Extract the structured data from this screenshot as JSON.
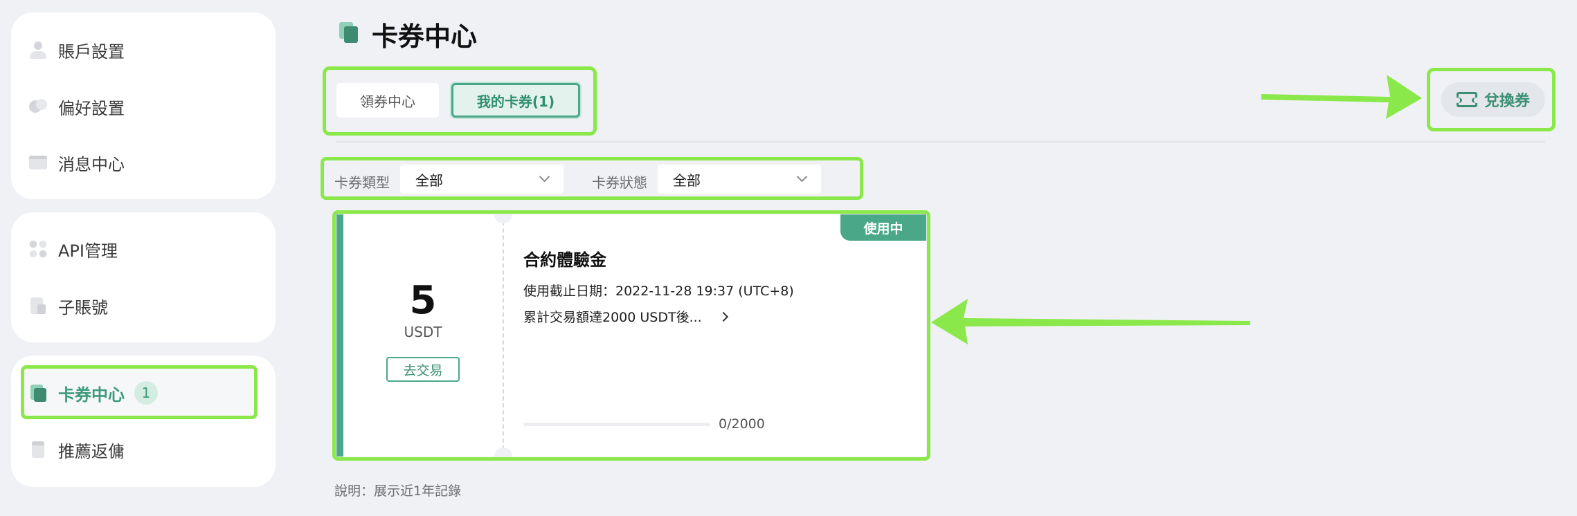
{
  "sidebar": {
    "groups": [
      {
        "items": [
          {
            "label": "賬戶設置",
            "icon": "user-icon"
          },
          {
            "label": "偏好設置",
            "icon": "preferences-icon"
          },
          {
            "label": "消息中心",
            "icon": "message-icon"
          }
        ]
      },
      {
        "items": [
          {
            "label": "API管理",
            "icon": "api-icon"
          },
          {
            "label": "子賬號",
            "icon": "sub-account-icon"
          }
        ]
      },
      {
        "items": [
          {
            "label": "卡券中心",
            "icon": "coupon-icon",
            "badge": "1",
            "active": true
          },
          {
            "label": "推薦返傭",
            "icon": "referral-icon"
          }
        ]
      }
    ]
  },
  "header": {
    "title": "卡券中心"
  },
  "tabs": [
    {
      "label": "領券中心",
      "active": false
    },
    {
      "label": "我的卡券(1)",
      "active": true
    }
  ],
  "redeem": {
    "label": "兌換券"
  },
  "filters": {
    "type": {
      "label": "卡券類型",
      "value": "全部"
    },
    "status": {
      "label": "卡券狀態",
      "value": "全部"
    }
  },
  "coupon": {
    "amount": "5",
    "currency": "USDT",
    "trade_label": "去交易",
    "status_tag": "使用中",
    "title": "合約體驗金",
    "expiry": "使用截止日期：2022-11-28 19:37 (UTC+8)",
    "condition": "累計交易額達2000 USDT後...",
    "progress_text": "0/2000",
    "progress": 0
  },
  "footnote": "說明：展示近1年記錄",
  "colors": {
    "accent": "#4aa888",
    "annotation": "#8be84a",
    "background": "#f0f1f5"
  }
}
